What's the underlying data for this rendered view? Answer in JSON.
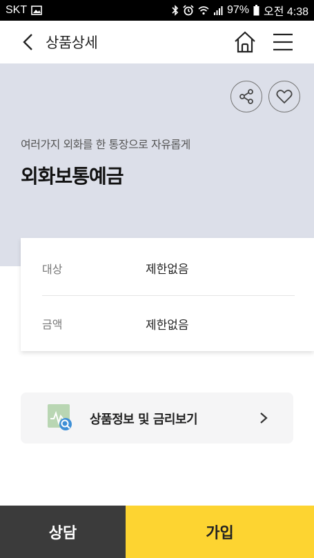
{
  "status_bar": {
    "carrier": "SKT",
    "battery_percent": "97%",
    "time": "오전 4:38",
    "icons": [
      "image-icon",
      "bluetooth-icon",
      "alarm-icon",
      "wifi-icon",
      "signal-icon",
      "battery-icon"
    ]
  },
  "header": {
    "title": "상품상세",
    "icons": {
      "back": "chevron-left-icon",
      "home": "home-icon",
      "menu": "hamburger-menu-icon"
    }
  },
  "hero": {
    "subtitle": "여러가지 외화를 한 통장으로 자유롭게",
    "title": "외화보통예금",
    "background_color": "#dcdfe9",
    "icons": {
      "share": "share-icon",
      "like": "heart-icon"
    }
  },
  "info": {
    "rows": [
      {
        "label": "대상",
        "value": "제한없음"
      },
      {
        "label": "금액",
        "value": "제한없음"
      }
    ]
  },
  "rate_button": {
    "label": "상품정보 및 금리보기",
    "icons": {
      "lead": "document-search-icon",
      "trail": "chevron-right-icon"
    }
  },
  "bottom": {
    "consult_label": "상담",
    "join_label": "가입",
    "consult_color": "#3b3b3b",
    "join_color": "#fdd431"
  }
}
